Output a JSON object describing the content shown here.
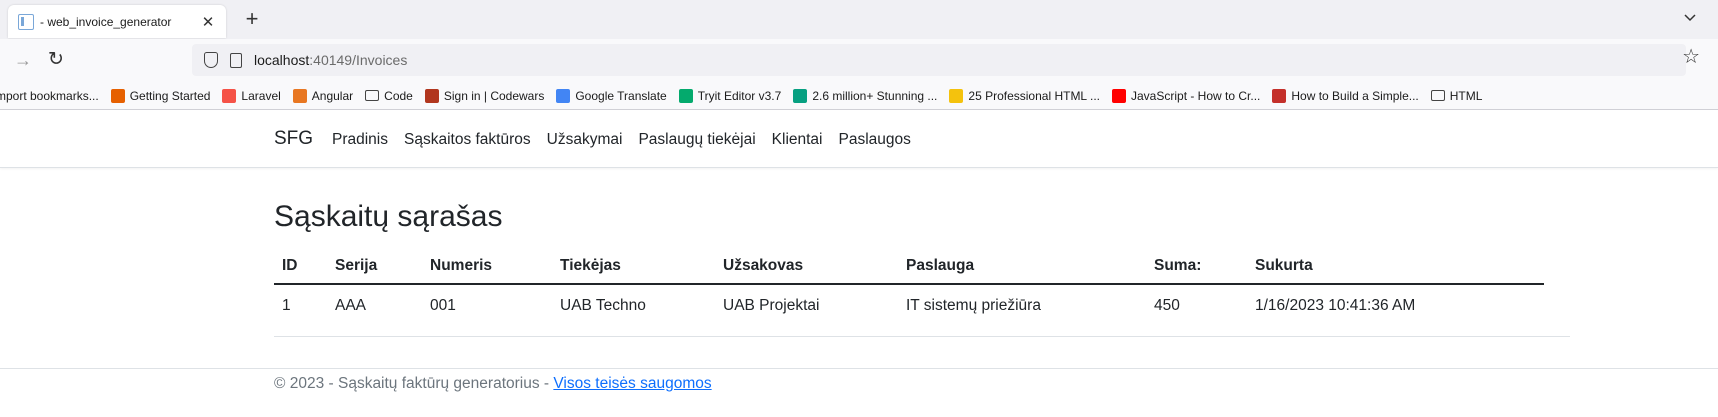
{
  "browser": {
    "tab_title": "- web_invoice_generator",
    "url_host": "localhost",
    "url_rest": ":40149/Invoices",
    "bookmarks": [
      {
        "label": "mport bookmarks...",
        "color": "transparent"
      },
      {
        "label": "Getting Started",
        "color": "#e66000"
      },
      {
        "label": "Laravel",
        "color": "#f55247"
      },
      {
        "label": "Angular",
        "color": "#e87722"
      },
      {
        "label": "Code",
        "color": "transparent"
      },
      {
        "label": "Sign in | Codewars",
        "color": "#b1361e"
      },
      {
        "label": "Google Translate",
        "color": "#4285f4"
      },
      {
        "label": "Tryit Editor v3.7",
        "color": "#04aa6d"
      },
      {
        "label": "2.6 million+ Stunning ...",
        "color": "#07a081"
      },
      {
        "label": "25 Professional HTML ...",
        "color": "#f4c20d"
      },
      {
        "label": "JavaScript - How to Cr...",
        "color": "#ff0000"
      },
      {
        "label": "How to Build a Simple...",
        "color": "#c4302b"
      },
      {
        "label": "HTML",
        "color": "transparent"
      }
    ]
  },
  "site": {
    "brand": "SFG",
    "nav": [
      "Pradinis",
      "Sąskaitos faktūros",
      "Užsakymai",
      "Paslaugų tiekėjai",
      "Klientai",
      "Paslaugos"
    ]
  },
  "main": {
    "title": "Sąskaitų sąrašas",
    "columns": [
      "ID",
      "Serija",
      "Numeris",
      "Tiekėjas",
      "Užsakovas",
      "Paslauga",
      "Suma:",
      "Sukurta"
    ],
    "rows": [
      [
        "1",
        "AAA",
        "001",
        "UAB Techno",
        "UAB Projektai",
        "IT sistemų priežiūra",
        "450",
        "1/16/2023 10:41:36 AM"
      ]
    ]
  },
  "footer": {
    "text": "© 2023 - Sąskaitų faktūrų generatorius - ",
    "link": "Visos teisės saugomos"
  }
}
